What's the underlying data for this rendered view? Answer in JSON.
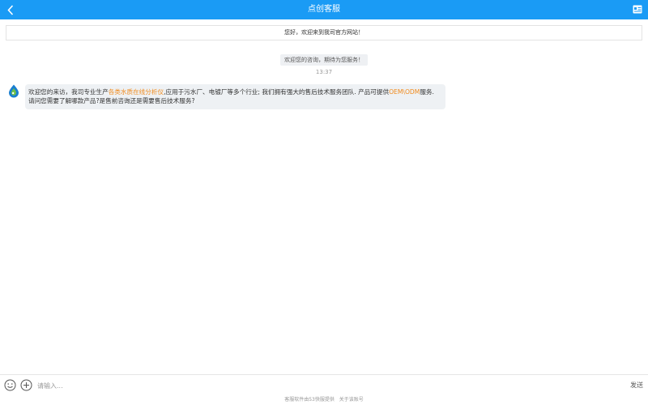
{
  "header": {
    "title": "点创客服",
    "back_icon": "chevron-left-icon",
    "contact_icon": "contact-card-icon",
    "color": "#1a9bf5"
  },
  "notice": {
    "text": "您好，欢迎来到我司官方网站！"
  },
  "system_message": {
    "text": "欢迎您的咨询，期待为您服务！"
  },
  "timestamp": "13:37",
  "message": {
    "line1_a": "欢迎您的来访，我司专业生产",
    "line1_hl1": "各类水质在线分析仪",
    "line1_b": ",应用于污水厂、电镀厂等多个行业; 我们拥有强大的售后技术服务团队. 产品可提供",
    "line1_hl2": "OEM\\ODM",
    "line1_c": "服务.",
    "line2": "请问您需要了解哪款产品?是售前咨询还是需要售后技术服务?",
    "highlight_color": "#f08a1c"
  },
  "composer": {
    "placeholder": "请输入...",
    "send_label": "发送",
    "emoji_icon": "emoji-icon",
    "add_icon": "add-icon"
  },
  "footer": {
    "powered": "客服软件由53快服提供",
    "about": "关于该账号"
  }
}
